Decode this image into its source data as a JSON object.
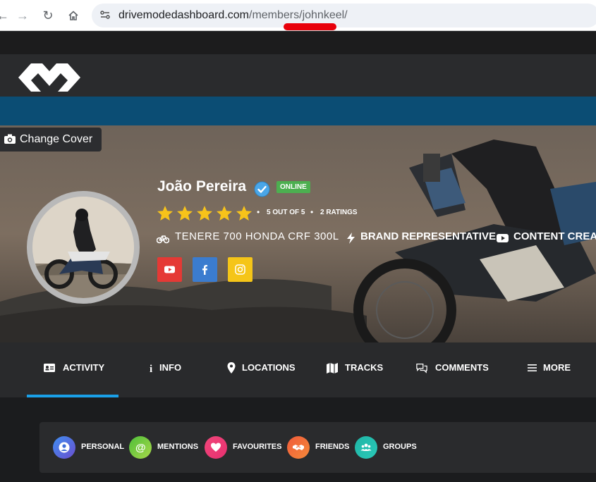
{
  "browser": {
    "url_domain": "drivemodedashboard.com",
    "url_path": "/members/johnkeel/"
  },
  "cover": {
    "change_cover_label": "Change Cover"
  },
  "profile": {
    "name": "João Pereira",
    "status_badge": "ONLINE",
    "rating_value": 5,
    "rating_text": "5 OUT OF 5",
    "rating_count": "2 RATINGS",
    "motorcycles": "TENERE 700 HONDA CRF 300L",
    "role_1": "BRAND REPRESENTATIVE",
    "role_2": "CONTENT CREATOR"
  },
  "social": [
    {
      "name": "youtube",
      "color": "#e53935"
    },
    {
      "name": "facebook",
      "color": "#3b7ccf"
    },
    {
      "name": "instagram",
      "color": "#f5c518"
    }
  ],
  "tabs": [
    {
      "label": "ACTIVITY",
      "icon": "id-card-icon",
      "active": true
    },
    {
      "label": "INFO",
      "icon": "info-icon"
    },
    {
      "label": "LOCATIONS",
      "icon": "map-pin-icon"
    },
    {
      "label": "TRACKS",
      "icon": "map-icon"
    },
    {
      "label": "COMMENTS",
      "icon": "comments-icon"
    },
    {
      "label": "MORE",
      "icon": "menu-icon"
    }
  ],
  "filters": [
    {
      "label": "PERSONAL",
      "icon": "user-icon",
      "color": "#3a6fd8"
    },
    {
      "label": "MENTIONS",
      "icon": "at-icon",
      "color": "#6bbf3a"
    },
    {
      "label": "FAVOURITES",
      "icon": "heart-icon",
      "color": "#ee3f7a"
    },
    {
      "label": "FRIENDS",
      "icon": "handshake-icon",
      "color": "#f06a3b"
    },
    {
      "label": "GROUPS",
      "icon": "users-icon",
      "color": "#1fb5a6"
    }
  ],
  "colors": {
    "accent": "#1aa0e8",
    "online": "#4caf50",
    "star": "#f7c31a",
    "header_blue": "#0b4d74"
  }
}
